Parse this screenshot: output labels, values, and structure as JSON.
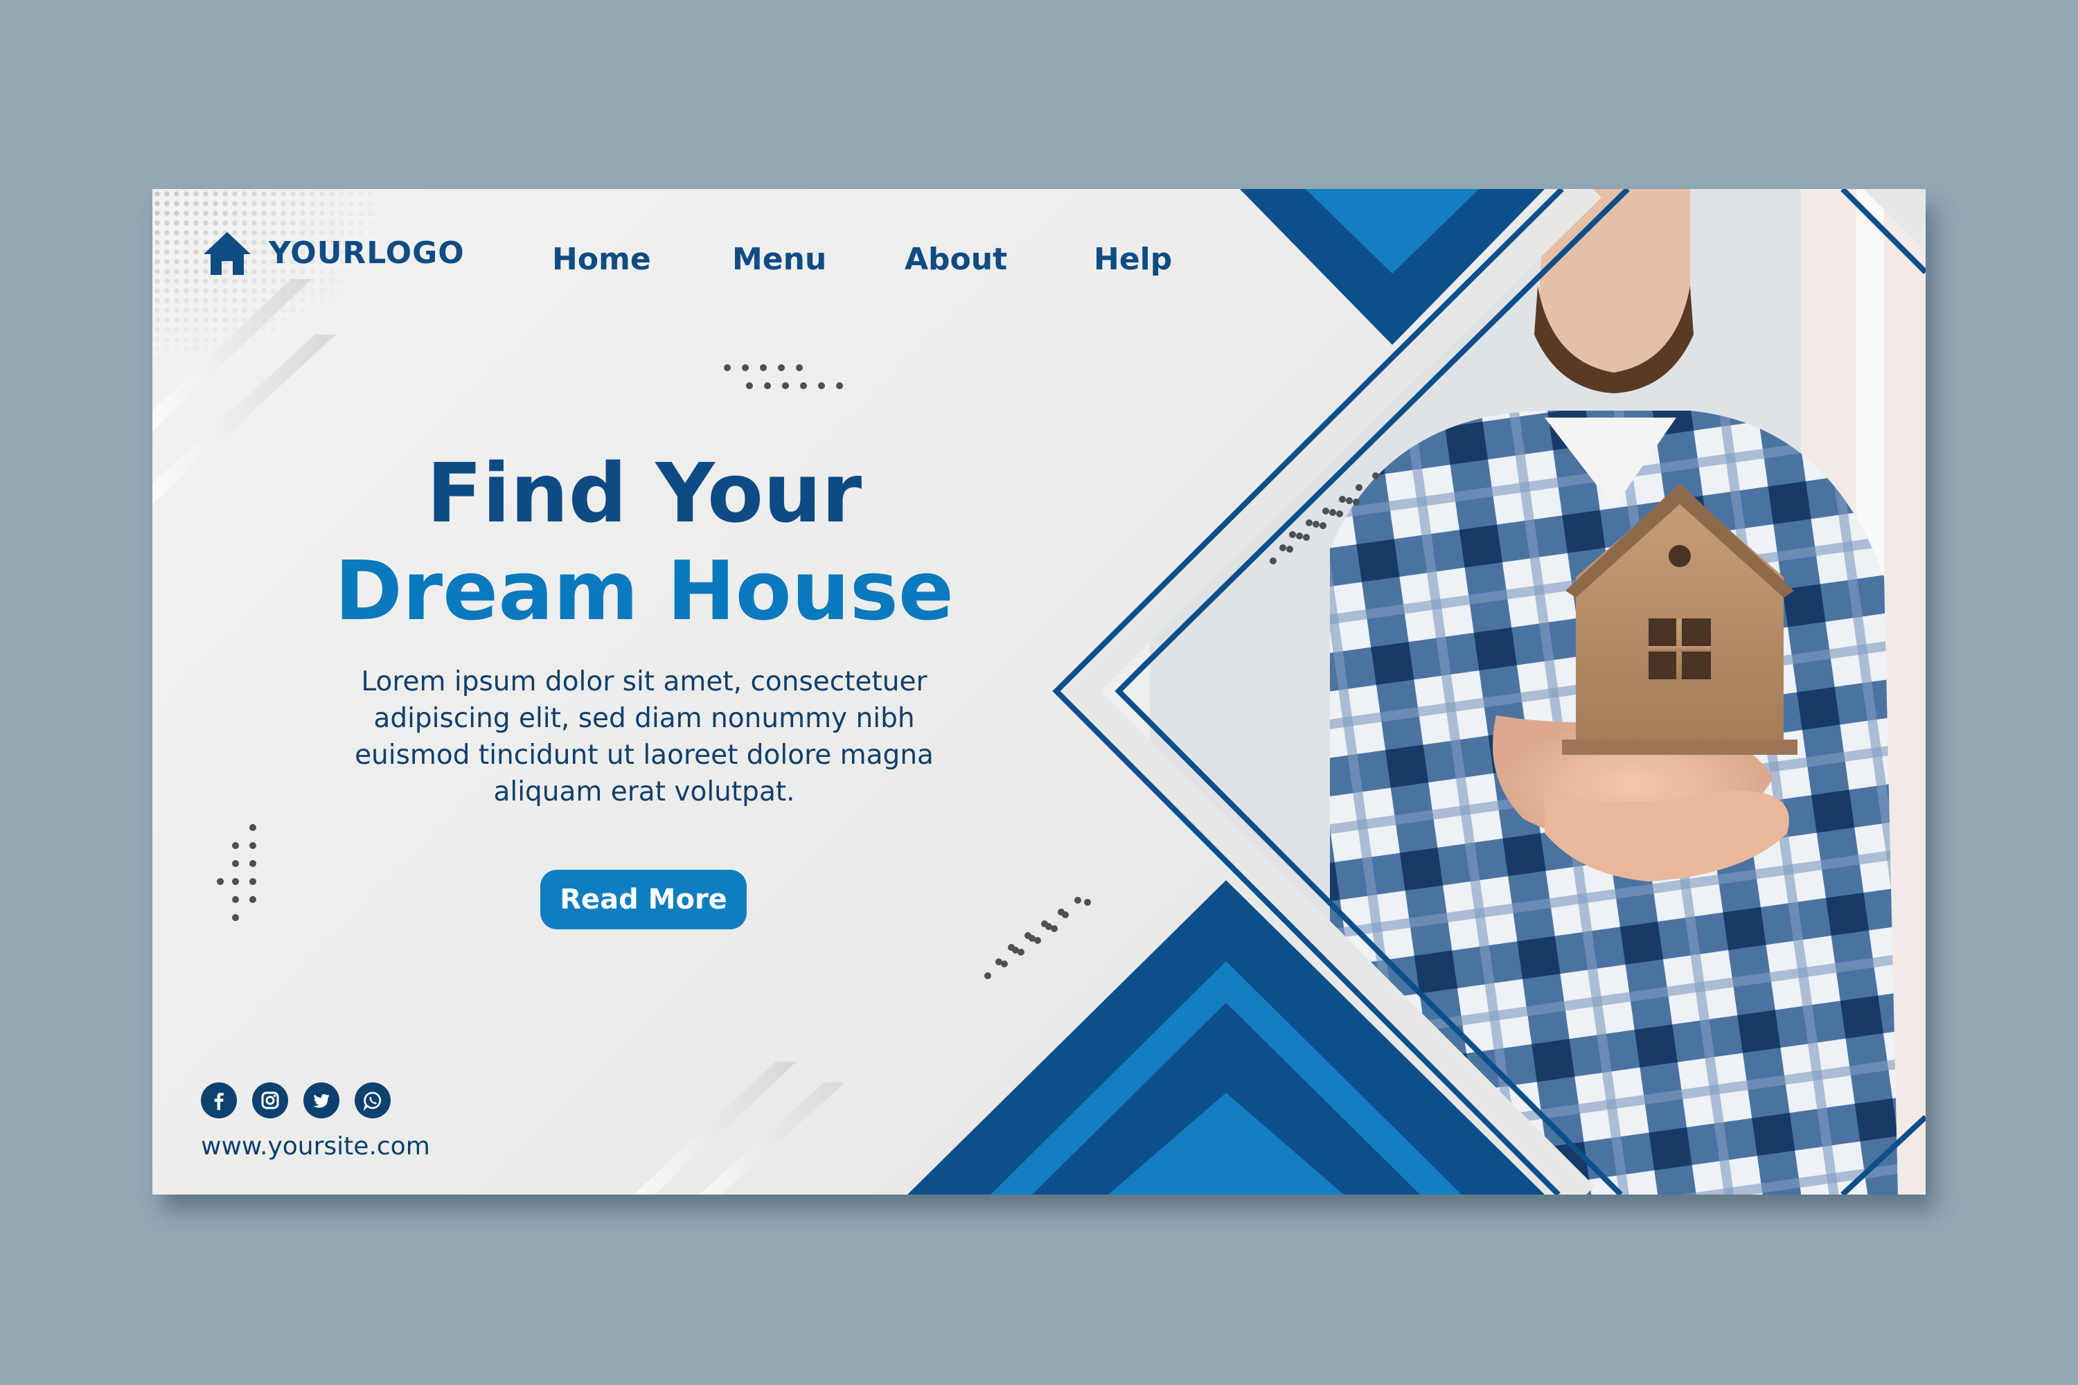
{
  "logo": {
    "text": "YOURLOGO",
    "icon": "home-icon"
  },
  "nav": {
    "items": [
      "Home",
      "Menu",
      "About",
      "Help"
    ]
  },
  "hero": {
    "title_line1": "Find Your",
    "title_line2": "Dream House",
    "body": "Lorem ipsum dolor sit amet, consectetuer adipiscing elit, sed diam nonummy nibh euismod tincidunt ut laoreet dolore magna aliquam erat volutpat.",
    "button_label": "Read More"
  },
  "footer": {
    "social_icons": [
      "facebook-icon",
      "instagram-icon",
      "twitter-icon",
      "whatsapp-icon"
    ],
    "website": "www.yoursite.com"
  },
  "colors": {
    "background": "#94a9b6",
    "navy": "#0e4b84",
    "bright_blue": "#0a79bd",
    "button": "#0e7ec0",
    "triangle_dark": "#0d4f8b",
    "triangle_light": "#137ec2"
  }
}
